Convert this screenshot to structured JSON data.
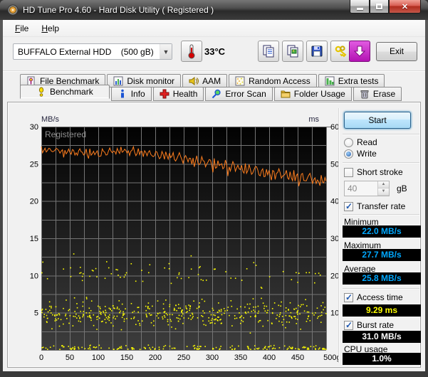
{
  "window": {
    "title": "HD Tune Pro 4.60 - Hard Disk Utility (  Registered )",
    "caption_buttons": {
      "minimize": "minimize",
      "maximize": "maximize",
      "close": "x"
    }
  },
  "menu": {
    "items": [
      {
        "key": "F",
        "rest": "ile"
      },
      {
        "key": "H",
        "rest": "elp"
      }
    ]
  },
  "toolbar": {
    "drive_select": {
      "value": "BUFFALO External HDD    (500 gB)"
    },
    "temperature": "33°C",
    "buttons": [
      {
        "name": "copy-text"
      },
      {
        "name": "copy-image"
      },
      {
        "name": "save"
      },
      {
        "name": "options"
      },
      {
        "name": "update"
      }
    ],
    "exit_label": "Exit"
  },
  "tabs": {
    "row1": [
      {
        "label": "File Benchmark"
      },
      {
        "label": "Disk monitor"
      },
      {
        "label": "AAM"
      },
      {
        "label": "Random Access"
      },
      {
        "label": "Extra tests"
      }
    ],
    "row2": [
      {
        "label": "Benchmark",
        "active": true
      },
      {
        "label": "Info"
      },
      {
        "label": "Health"
      },
      {
        "label": "Error Scan"
      },
      {
        "label": "Folder Usage"
      },
      {
        "label": "Erase"
      }
    ]
  },
  "panel": {
    "start_button": "Start",
    "read_label": "Read",
    "write_label": "Write",
    "mode_selected": "Write",
    "short_stroke": {
      "label": "Short stroke",
      "checked": false,
      "value": "40",
      "unit": "gB"
    },
    "transfer_rate": {
      "label": "Transfer rate",
      "checked": true
    },
    "minimum": {
      "label": "Minimum",
      "value": "22.0 MB/s"
    },
    "maximum": {
      "label": "Maximum",
      "value": "27.7 MB/s"
    },
    "average": {
      "label": "Average",
      "value": "25.8 MB/s"
    },
    "access_time": {
      "label": "Access time",
      "checked": true,
      "value": "9.29 ms"
    },
    "burst_rate": {
      "label": "Burst rate",
      "checked": true,
      "value": "31.0 MB/s"
    },
    "cpu_usage": {
      "label": "CPU usage",
      "value": "1.0%"
    }
  },
  "colors": {
    "value_cyan": "#00a8ff",
    "value_yellow": "#ffff00",
    "value_white": "#ffffff",
    "chart_line_orange": "#ff7e1e",
    "chart_scatter_yellow": "#ffff00",
    "close_button_red": "#b02b1c",
    "update_button_magenta": "#c41ec4"
  },
  "chart_data": {
    "type": "line",
    "watermark": "Registered",
    "x_axis": {
      "min": 0,
      "max": 500,
      "grid_step": 25,
      "tick_step": 50,
      "tick_labels": [
        "0",
        "50",
        "100",
        "150",
        "200",
        "250",
        "300",
        "350",
        "400",
        "450",
        "500gB"
      ]
    },
    "y_left": {
      "label": "MB/s",
      "min": 0,
      "max": 30,
      "grid_step": 2.5,
      "tick_step": 5,
      "tick_labels": [
        "5",
        "10",
        "15",
        "20",
        "25",
        "30"
      ]
    },
    "y_right": {
      "label": "ms",
      "min": 0,
      "max": 60,
      "tick_step": 10,
      "tick_labels": [
        "10",
        "20",
        "30",
        "40",
        "50",
        "60"
      ]
    },
    "series": [
      {
        "name": "transfer_rate",
        "type": "line",
        "unit": "MB/s",
        "color": "#ff7e1e",
        "stats": {
          "min": 22.0,
          "max": 27.7,
          "avg": 25.8
        },
        "peak_anchors": [
          [
            0,
            27.4
          ],
          [
            50,
            27.2
          ],
          [
            100,
            27.1
          ],
          [
            150,
            27.5
          ],
          [
            200,
            27.0
          ],
          [
            250,
            26.6
          ],
          [
            300,
            25.9
          ],
          [
            350,
            25.3
          ],
          [
            400,
            24.7
          ],
          [
            450,
            24.3
          ],
          [
            500,
            23.6
          ]
        ],
        "dip_amplitude": [
          0.9,
          2.1
        ],
        "points": 230
      },
      {
        "name": "access_time",
        "type": "scatter",
        "unit": "ms",
        "color": "#ffff00",
        "avg_ms": 9.29,
        "seed": 42,
        "clusters": [
          {
            "count": 430,
            "y_center": 4.9,
            "y_spread": 0.9,
            "desc": "main band ~10 ms"
          },
          {
            "count": 155,
            "y_center": 0.25,
            "y_spread": 0.18,
            "desc": "bottom band near 0"
          },
          {
            "count": 72,
            "y_center": 10.25,
            "y_spread": 0.72,
            "desc": "upper band ~20 ms"
          },
          {
            "count": 2,
            "y_center": 12.75,
            "y_spread": 0.1,
            "x_values": [
              57,
              263
            ],
            "desc": "outliers ~25 ms"
          }
        ]
      }
    ]
  }
}
